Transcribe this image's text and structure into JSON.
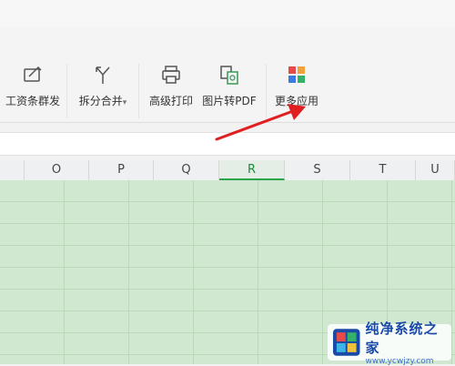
{
  "ribbon": {
    "items": [
      {
        "label": "工资条群发",
        "icon": "payslip-icon"
      },
      {
        "label": "拆分合并",
        "icon": "split-merge-icon",
        "dropdown": true
      },
      {
        "label": "高级打印",
        "icon": "printer-icon"
      },
      {
        "label": "图片转PDF",
        "icon": "image-to-pdf-icon"
      },
      {
        "label": "更多应用",
        "icon": "more-apps-icon"
      }
    ],
    "dropdown_glyph": "▾"
  },
  "columns": [
    "O",
    "P",
    "Q",
    "R",
    "S",
    "T",
    "U"
  ],
  "active_column": "R",
  "watermark": {
    "title": "纯净系统之家",
    "url": "www.ycwjzy.com"
  },
  "colors": {
    "grid_fill": "#cfe8cf",
    "active_column": "#2aa54a",
    "arrow": "#e02020"
  }
}
